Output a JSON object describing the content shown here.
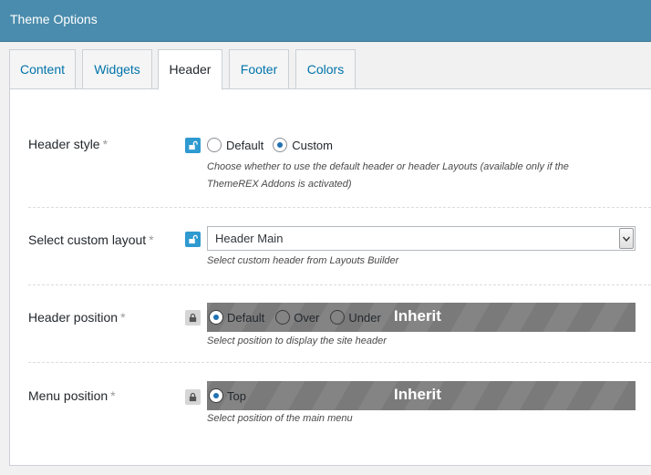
{
  "window": {
    "title": "Theme Options"
  },
  "tabs": [
    {
      "label": "Content",
      "active": false
    },
    {
      "label": "Widgets",
      "active": false
    },
    {
      "label": "Header",
      "active": true
    },
    {
      "label": "Footer",
      "active": false
    },
    {
      "label": "Colors",
      "active": false
    }
  ],
  "colors": {
    "titlebar": "#4a8cad",
    "link": "#0073aa",
    "lock_open": "#2e9ad0",
    "lock_closed": "#d6d6d6",
    "inherit_bar": "#7a7a7a"
  },
  "fields": {
    "header_style": {
      "label": "Header style",
      "required_mark": "*",
      "lock_icon": "unlock-icon",
      "options": [
        {
          "label": "Default",
          "selected": false
        },
        {
          "label": "Custom",
          "selected": true
        }
      ],
      "description": "Choose whether to use the default header or header Layouts (available only if the ThemeREX Addons is activated)"
    },
    "custom_layout": {
      "label": "Select custom layout",
      "required_mark": "*",
      "lock_icon": "unlock-icon",
      "value": "Header Main",
      "description": "Select custom header from Layouts Builder"
    },
    "header_position": {
      "label": "Header position",
      "required_mark": "*",
      "lock_icon": "lock-icon",
      "options": [
        {
          "label": "Default",
          "selected": true
        },
        {
          "label": "Over",
          "selected": false
        },
        {
          "label": "Under",
          "selected": false
        }
      ],
      "inherit_label": "Inherit",
      "description": "Select position to display the site header"
    },
    "menu_position": {
      "label": "Menu position",
      "required_mark": "*",
      "lock_icon": "lock-icon",
      "options": [
        {
          "label": "Top",
          "selected": true
        }
      ],
      "inherit_label": "Inherit",
      "description": "Select position of the main menu"
    }
  }
}
